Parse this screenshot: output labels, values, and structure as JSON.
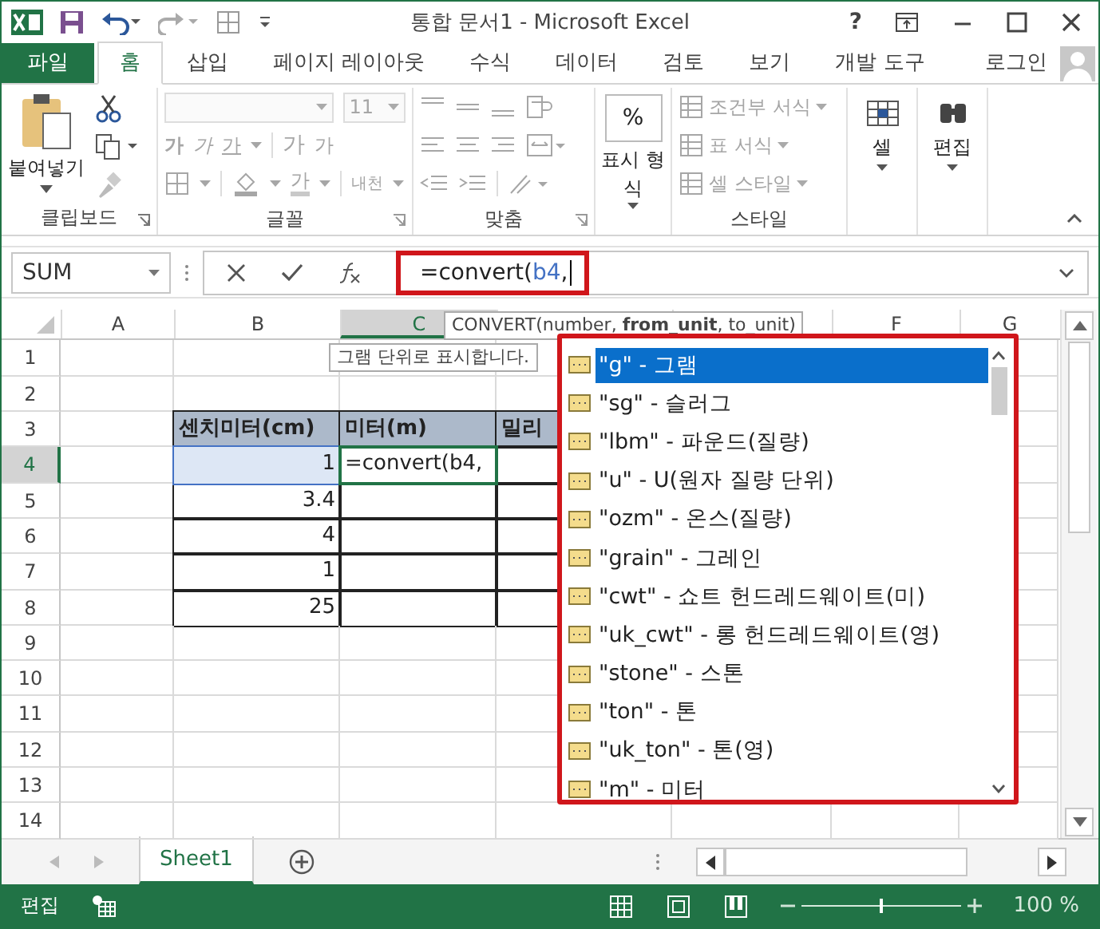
{
  "window": {
    "title": "통합 문서1 - Microsoft Excel",
    "help": "?"
  },
  "tabs": [
    {
      "label": "파일",
      "kind": "file",
      "selected": false
    },
    {
      "label": "홈",
      "kind": "tab",
      "selected": true
    },
    {
      "label": "삽입",
      "kind": "tab",
      "selected": false
    },
    {
      "label": "페이지 레이아웃",
      "kind": "tab",
      "selected": false
    },
    {
      "label": "수식",
      "kind": "tab",
      "selected": false
    },
    {
      "label": "데이터",
      "kind": "tab",
      "selected": false
    },
    {
      "label": "검토",
      "kind": "tab",
      "selected": false
    },
    {
      "label": "보기",
      "kind": "tab",
      "selected": false
    },
    {
      "label": "개발 도구",
      "kind": "tab",
      "selected": false
    }
  ],
  "account": {
    "label": "로그인"
  },
  "ribbon": {
    "clipboard": {
      "label": "클립보드",
      "paste": "붙여넣기"
    },
    "font": {
      "label": "글꼴",
      "disabled": true,
      "size": "11",
      "style_buttons": [
        "가",
        "가",
        "가"
      ],
      "size_buttons": [
        "가",
        "가"
      ],
      "color_button": "가",
      "phonetic": "내천"
    },
    "alignment": {
      "label": "맞춤",
      "disabled": true
    },
    "number": {
      "symbol": "%",
      "button": "표시 형식"
    },
    "styles": {
      "label": "스타일",
      "disabled": true,
      "items": [
        "조건부 서식",
        "표 서식",
        "셀 스타일"
      ]
    },
    "cells": {
      "button": "셀"
    },
    "editing": {
      "button": "편집"
    }
  },
  "formula_bar": {
    "name_box": "SUM",
    "formula": {
      "before": "=convert(",
      "ref": "b4",
      "after": ","
    }
  },
  "sheet": {
    "columns": [
      {
        "label": "A",
        "selected": false
      },
      {
        "label": "B",
        "selected": false
      },
      {
        "label": "C",
        "selected": true
      },
      {
        "selected": false
      },
      {
        "selected": false
      },
      {
        "label": "F",
        "selected": false
      },
      {
        "label": "G",
        "selected": false
      }
    ],
    "rows": [
      {
        "label": "1",
        "selected": false
      },
      {
        "label": "2",
        "selected": false
      },
      {
        "label": "3",
        "selected": false,
        "cells": {
          "B": {
            "text": "센치미터(cm)",
            "kind": "header",
            "selected": false,
            "referenced": false
          },
          "C": {
            "text": "미터(m)",
            "kind": "header",
            "selected": false,
            "referenced": false
          },
          "D": {
            "text": "밀리",
            "kind": "header",
            "selected": false,
            "referenced": false
          }
        }
      },
      {
        "label": "4",
        "selected": true,
        "cells": {
          "B": {
            "text": "1",
            "kind": "number",
            "selected": false,
            "referenced": true
          },
          "C": {
            "text": "=convert(b4,",
            "kind": "text",
            "selected": true,
            "referenced": false
          },
          "D": {
            "kind": "table",
            "selected": false,
            "referenced": false
          }
        }
      },
      {
        "label": "5",
        "selected": false,
        "cells": {
          "B": {
            "text": "3.4",
            "kind": "number",
            "selected": false,
            "referenced": false
          },
          "C": {
            "kind": "table",
            "selected": false,
            "referenced": false
          },
          "D": {
            "kind": "table",
            "selected": false,
            "referenced": false
          }
        }
      },
      {
        "label": "6",
        "selected": false,
        "cells": {
          "B": {
            "text": "4",
            "kind": "number",
            "selected": false,
            "referenced": false
          },
          "C": {
            "kind": "table",
            "selected": false,
            "referenced": false
          },
          "D": {
            "kind": "table",
            "selected": false,
            "referenced": false
          }
        }
      },
      {
        "label": "7",
        "selected": false,
        "cells": {
          "B": {
            "text": "1",
            "kind": "number",
            "selected": false,
            "referenced": false
          },
          "C": {
            "kind": "table",
            "selected": false,
            "referenced": false
          },
          "D": {
            "kind": "table",
            "selected": false,
            "referenced": false
          }
        }
      },
      {
        "label": "8",
        "selected": false,
        "cells": {
          "B": {
            "text": "25",
            "kind": "number",
            "selected": false,
            "referenced": false
          },
          "C": {
            "kind": "table",
            "selected": false,
            "referenced": false
          },
          "D": {
            "kind": "table",
            "selected": false,
            "referenced": false
          }
        }
      },
      {
        "label": "9",
        "selected": false
      },
      {
        "label": "10",
        "selected": false
      },
      {
        "label": "11",
        "selected": false
      },
      {
        "label": "12",
        "selected": false
      },
      {
        "label": "13",
        "selected": false
      },
      {
        "label": "14",
        "selected": false
      }
    ]
  },
  "signature_tip": "CONVERT(number, **from_unit**, to_unit)",
  "description_tip": "그램 단위로 표시합니다.",
  "autocomplete": [
    {
      "label": "\"g\" - 그램",
      "selected": true
    },
    {
      "label": "\"sg\" - 슬러그",
      "selected": false
    },
    {
      "label": "\"lbm\" - 파운드(질량)",
      "selected": false
    },
    {
      "label": "\"u\" - U(원자 질량 단위)",
      "selected": false
    },
    {
      "label": "\"ozm\" - 온스(질량)",
      "selected": false
    },
    {
      "label": "\"grain\" - 그레인",
      "selected": false
    },
    {
      "label": "\"cwt\" - 쇼트 헌드레드웨이트(미)",
      "selected": false
    },
    {
      "label": "\"uk_cwt\" - 롱 헌드레드웨이트(영)",
      "selected": false
    },
    {
      "label": "\"stone\" - 스톤",
      "selected": false
    },
    {
      "label": "\"ton\" - 톤",
      "selected": false
    },
    {
      "label": "\"uk_ton\" - 톤(영)",
      "selected": false
    },
    {
      "label": "\"m\" - 미터",
      "selected": false
    }
  ],
  "sheet_tabs": [
    {
      "label": "Sheet1",
      "selected": true
    }
  ],
  "status_bar": {
    "mode": "편집",
    "zoom": "100 %",
    "zoom_slider": {
      "level": 0.5
    }
  }
}
